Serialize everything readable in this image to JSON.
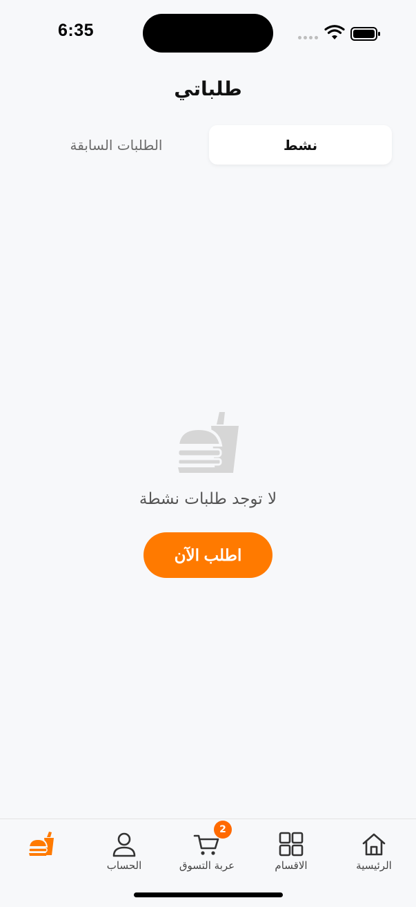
{
  "status_bar": {
    "time": "6:35"
  },
  "header": {
    "title": "طلباتي"
  },
  "tabs": {
    "active_label": "نشط",
    "inactive_label": "الطلبات السابقة"
  },
  "empty_state": {
    "icon": "burger-drink-icon",
    "message": "لا توجد طلبات نشطة",
    "button_label": "اطلب الآن"
  },
  "bottom_nav": {
    "items": [
      {
        "label": "الرئيسية",
        "icon": "home-icon"
      },
      {
        "label": "الاقسام",
        "icon": "grid-icon"
      },
      {
        "label": "عربة التسوق",
        "icon": "cart-icon",
        "badge": "2"
      },
      {
        "label": "الحساب",
        "icon": "user-icon"
      },
      {
        "label": "",
        "icon": "orders-icon"
      }
    ]
  },
  "colors": {
    "accent": "#ff7a00",
    "background": "#f7f8fa",
    "icon_muted": "#d6d6d6"
  }
}
